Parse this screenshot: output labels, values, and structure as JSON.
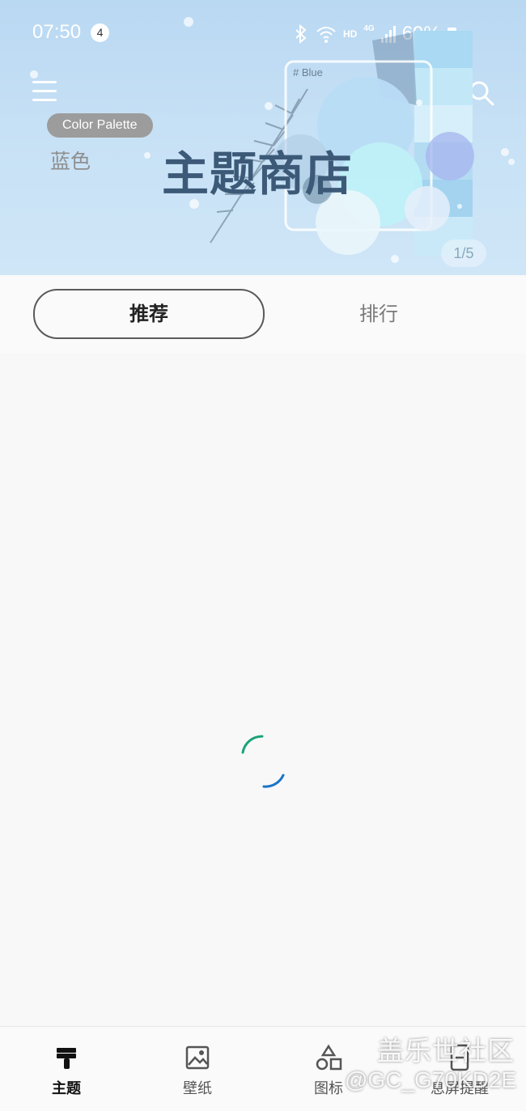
{
  "status_bar": {
    "time": "07:50",
    "notification_count": "4",
    "hd": "HD",
    "network": "4G",
    "battery": "69%"
  },
  "banner": {
    "badge": "Color Palette",
    "color_name": "蓝色",
    "title": "主题商店",
    "swatch_label": "# Blue",
    "page_indicator": "1/5"
  },
  "tabs": [
    {
      "label": "推荐",
      "active": true
    },
    {
      "label": "排行",
      "active": false
    }
  ],
  "bottom_nav": [
    {
      "label": "主题",
      "icon": "brush-icon",
      "active": true
    },
    {
      "label": "壁纸",
      "icon": "image-icon",
      "active": false
    },
    {
      "label": "图标",
      "icon": "shapes-icon",
      "active": false
    },
    {
      "label": "息屏提醒",
      "icon": "aod-icon",
      "active": false
    }
  ],
  "watermark": {
    "line1": "盖乐世社区",
    "line2": "@GC_G70KD2E"
  },
  "colors": {
    "banner_bg": "#c6e0f5",
    "title": "#3c5a78",
    "spinner_green": "#1aa37a",
    "spinner_blue": "#1a73c8"
  }
}
